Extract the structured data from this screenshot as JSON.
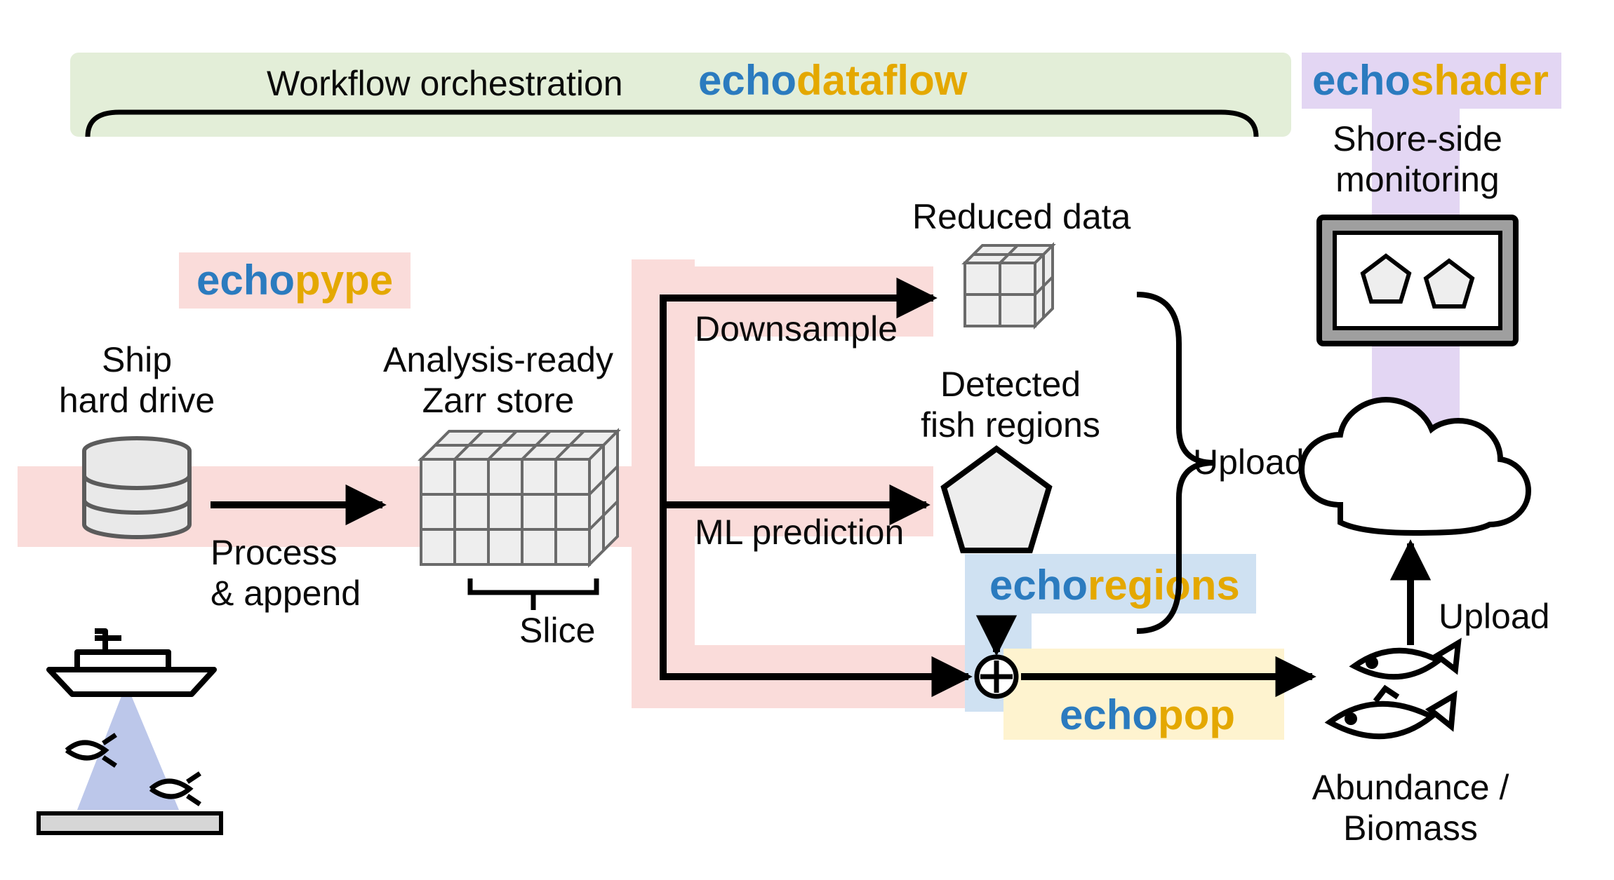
{
  "nodes": {
    "ship_hard_drive": "Ship<br>hard drive",
    "zarr_store": "Analysis-ready<br>Zarr store",
    "reduced_data": "Reduced data",
    "detected_regions": "Detected<br>fish regions",
    "cloud": "Cloud",
    "shore_monitoring": "Shore-side<br>monitoring",
    "abundance_biomass": "Abundance /<br>Biomass"
  },
  "edges": {
    "process_append": "Process<br>& append",
    "slice": "Slice",
    "downsample": "Downsample",
    "ml_prediction": "ML prediction",
    "upload_top": "Upload",
    "upload_bottom": "Upload",
    "workflow_orchestration": "Workflow orchestration"
  },
  "tools": {
    "echodataflow": {
      "prefix": "echo",
      "suffix": "dataflow"
    },
    "echopype": {
      "prefix": "echo",
      "suffix": "pype"
    },
    "echoregions": {
      "prefix": "echo",
      "suffix": "regions"
    },
    "echopop": {
      "prefix": "echo",
      "suffix": "pop"
    },
    "echoshader": {
      "prefix": "echo",
      "suffix": "shader"
    }
  },
  "colors": {
    "bg_green": "#e3eed8",
    "bg_pink": "#fadcda",
    "bg_blue": "#cfe1f2",
    "bg_yellow": "#fef3cf",
    "bg_purple": "#e3d6f3",
    "blue_text": "#2b7bbf",
    "gold_text": "#e4a800"
  }
}
